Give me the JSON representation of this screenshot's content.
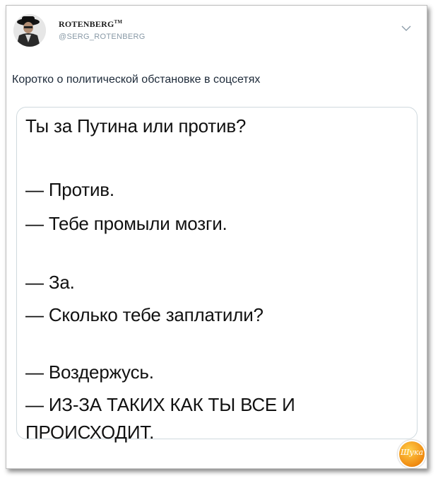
{
  "header": {
    "display_name": "ROTENBERG",
    "trademark": "TM",
    "handle": "@SERG_ROTENBERG"
  },
  "tweet": {
    "text": "Коротко о политической обстановке в соцсетях"
  },
  "card": {
    "lines": [
      "Ты за Путина или против?",
      "— Против.",
      "— Тебе промыли мозги.",
      "— За.",
      "— Сколько тебе заплатили?",
      "— Воздержусь.",
      "— ИЗ-ЗА ТАКИХ КАК ТЫ ВСЕ И",
      "ПРОИСХОДИТ."
    ]
  },
  "watermark": {
    "text": "Шука"
  },
  "icons": {
    "menu": "chevron-down-icon",
    "avatar": "avatar"
  },
  "colors": {
    "handle": "#8899a6",
    "card_border": "#cfd9de",
    "badge": "#f08a10"
  }
}
